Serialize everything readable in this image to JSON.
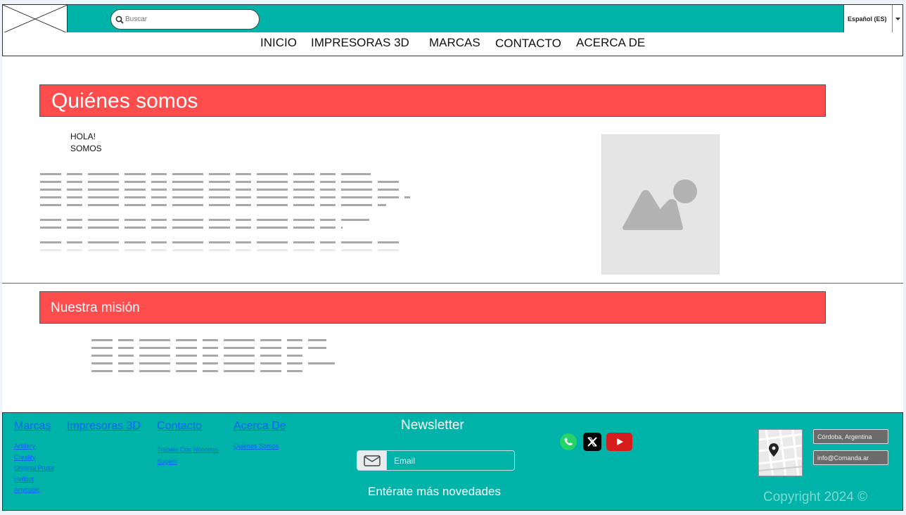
{
  "header": {
    "search": {
      "placeholder": "Buscar"
    },
    "language": "Español (ES)"
  },
  "nav": {
    "items": [
      "INICIO",
      "IMPRESORAS 3D",
      "MARCAS",
      "CONTACTO",
      "ACERCA DE"
    ]
  },
  "about": {
    "title": "Quiénes somos",
    "intro_line1": "HOLA!",
    "intro_line2": "SOMOS",
    "image_icon": "image-placeholder-icon"
  },
  "mission": {
    "title": "Nuestra misión"
  },
  "footer": {
    "columns": [
      {
        "heading": "Marcas",
        "links": [
          "Artillery",
          "Creality",
          "Original Prusa",
          "Hellbot",
          "Anycubic"
        ]
      },
      {
        "heading": "Impresoras 3D",
        "links": []
      },
      {
        "heading": "Contacto",
        "links": [
          "Trabaja Con Nosotros",
          "Sugerir"
        ]
      },
      {
        "heading": "Acerca De",
        "links": [
          "Quienes Somos"
        ]
      }
    ],
    "newsletter": {
      "title": "Newsletter",
      "email_placeholder": "Email",
      "subtitle": "Entérate más novedades"
    },
    "social": [
      "whatsapp-icon",
      "x-twitter-icon",
      "youtube-icon"
    ],
    "location": "Córdoba, Argentina",
    "email": "info@Comanda.ar",
    "copyright": "Copyright 2024 ©"
  },
  "colors": {
    "teal": "#00b3a9",
    "red_banner": "#ff4d4d",
    "link_blue": "#0b62f0"
  }
}
